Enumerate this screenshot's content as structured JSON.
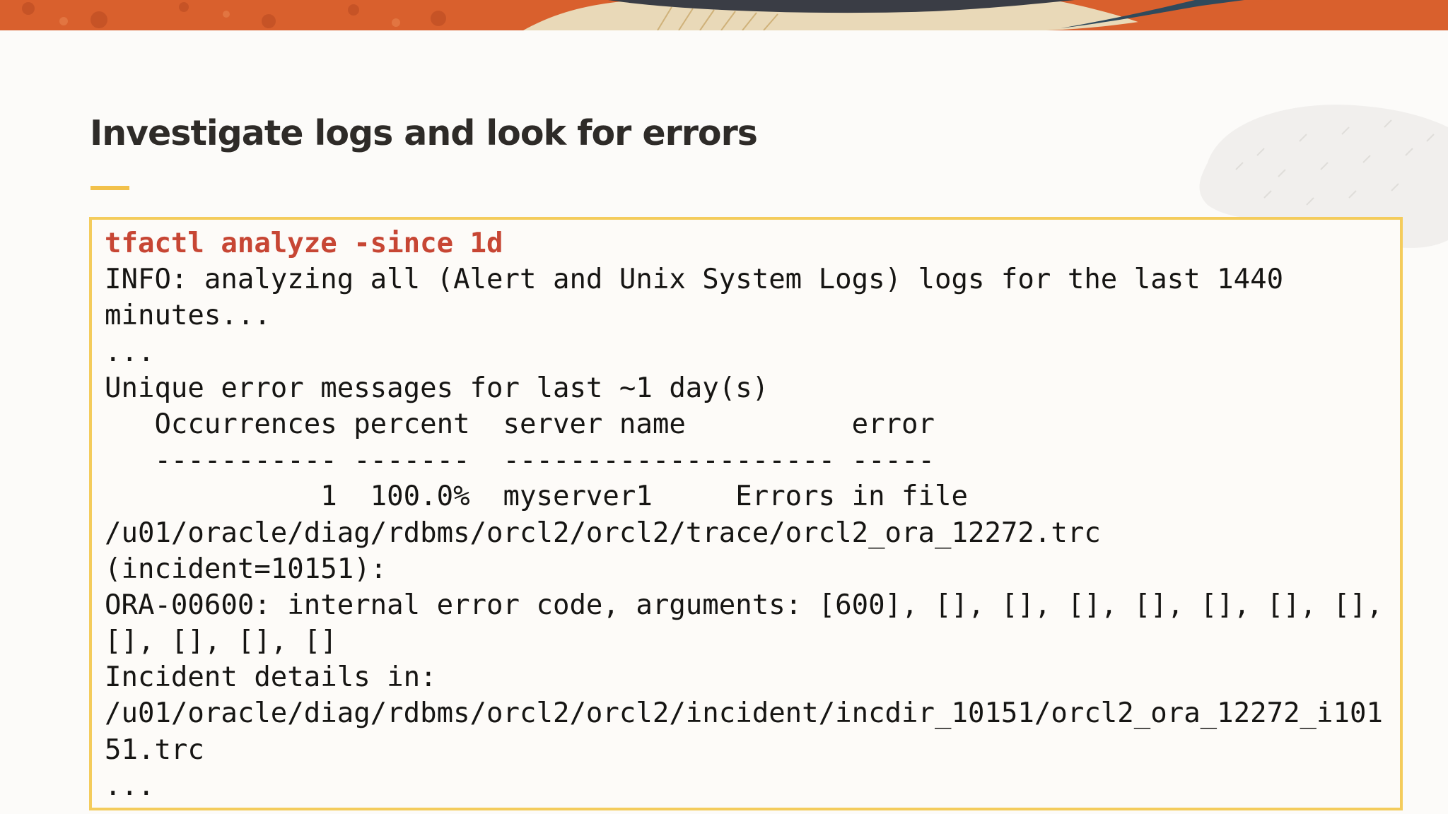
{
  "slide": {
    "title": "Investigate logs and look for errors"
  },
  "terminal": {
    "command": "tfactl analyze -since 1d",
    "output_lines": [
      "INFO: analyzing all (Alert and Unix System Logs) logs for the last 1440",
      "minutes...",
      "...",
      "Unique error messages for last ~1 day(s)",
      "   Occurrences percent  server name          error",
      "   ----------- -------  -------------------- -----",
      "             1  100.0%  myserver1     Errors in file",
      "/u01/oracle/diag/rdbms/orcl2/orcl2/trace/orcl2_ora_12272.trc",
      "(incident=10151):",
      "ORA-00600: internal error code, arguments: [600], [], [], [], [], [], [], [],",
      "[], [], [], []",
      "Incident details in:",
      "/u01/oracle/diag/rdbms/orcl2/orcl2/incident/incdir_10151/orcl2_ora_12272_i101",
      "51.trc",
      "..."
    ]
  },
  "colors": {
    "accent_orange": "#d9602d",
    "accent_yellow": "#f4cc5c",
    "command_red": "#c74634",
    "text_dark": "#161513",
    "background": "#fcfbf9"
  }
}
